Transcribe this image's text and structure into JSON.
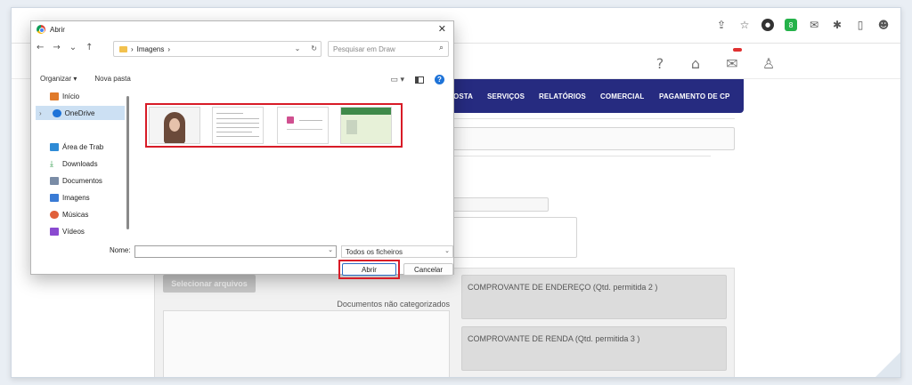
{
  "browser": {
    "icons": [
      "share-icon",
      "star-icon",
      "extension-red-icon",
      "extension-green-icon",
      "mail-extension-icon",
      "puzzle-icon",
      "sidebar-icon",
      "profile-icon"
    ],
    "green_badge": "8"
  },
  "site": {
    "header_icons": [
      "help-icon",
      "home-icon",
      "mail-icon",
      "user-icon"
    ],
    "nav": [
      "OSTA",
      "SERVIÇOS",
      "RELATÓRIOS",
      "COMERCIAL",
      "PAGAMENTO DE CP"
    ],
    "nav_color": "#262b80",
    "select_files_label": "Selecionar arquivos",
    "uncategorized_label": "Documentos não categorizados",
    "categories": [
      "COMPROVANTE DE ENDEREÇO (Qtd. permitida 2 )",
      "COMPROVANTE DE RENDA (Qtd. permitida 3 )"
    ]
  },
  "dialog": {
    "title": "Abrir",
    "path": [
      "Imagens"
    ],
    "search_placeholder": "Pesquisar em Draw",
    "organize": "Organizar ▾",
    "new_folder": "Nova pasta",
    "sidebar": [
      {
        "label": "Início",
        "color": "#e07a2a"
      },
      {
        "label": "OneDrive",
        "color": "#1e73d8"
      },
      {
        "label": "Área de Trab",
        "color": "#2e8bd6"
      },
      {
        "label": "Downloads",
        "color": "#2e9a4a"
      },
      {
        "label": "Documentos",
        "color": "#7a8ca6"
      },
      {
        "label": "Imagens",
        "color": "#3a7bd5"
      },
      {
        "label": "Músicas",
        "color": "#e0603a"
      },
      {
        "label": "Vídeos",
        "color": "#8a4ad0"
      }
    ],
    "name_label": "Nome:",
    "name_value": "",
    "file_type": "Todos os ficheiros",
    "open_button": "Abrir",
    "cancel_button": "Cancelar",
    "highlight_color": "#d81b27"
  }
}
